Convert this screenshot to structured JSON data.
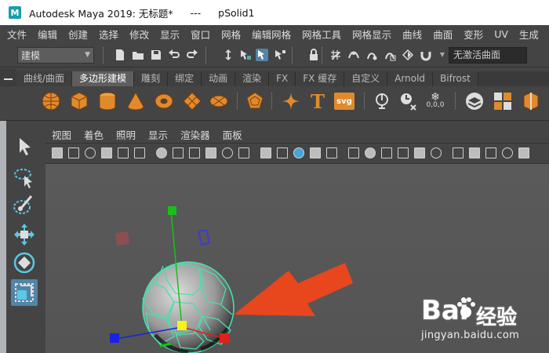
{
  "window": {
    "logo_letter": "M",
    "app_title": "Autodesk Maya 2019: 无标题*",
    "separator": "---",
    "object_name": "pSolid1"
  },
  "menubar": {
    "items": [
      "文件",
      "编辑",
      "创建",
      "选择",
      "修改",
      "显示",
      "窗口",
      "网格",
      "编辑网格",
      "网格工具",
      "网格显示",
      "曲线",
      "曲面",
      "变形",
      "UV",
      "生成"
    ]
  },
  "status_line": {
    "mode_dropdown": "建模",
    "no_active_surface": "无激活曲面"
  },
  "shelf": {
    "tabs": [
      "曲线/曲面",
      "多边形建模",
      "雕刻",
      "绑定",
      "动画",
      "渲染",
      "FX",
      "FX 缓存",
      "自定义",
      "Arnold",
      "Bifrost"
    ],
    "active_tab": "多边形建模",
    "text_tool_label": "T",
    "svg_tool_label": "svg",
    "bevel_numbers": "0,0,0"
  },
  "panel": {
    "menu": [
      "视图",
      "着色",
      "照明",
      "显示",
      "渲染器",
      "面板"
    ]
  },
  "viewport": {
    "object": "pSolid1",
    "manipulator_colors": {
      "x": "#e0201a",
      "y": "#17c11a",
      "z": "#1a22e0",
      "center": "#f4f41a"
    },
    "arrow_color": "#e8461c"
  },
  "watermark": {
    "brand_a": "Bai",
    "brand_b": "经验",
    "url": "jingyan.baidu.com"
  }
}
